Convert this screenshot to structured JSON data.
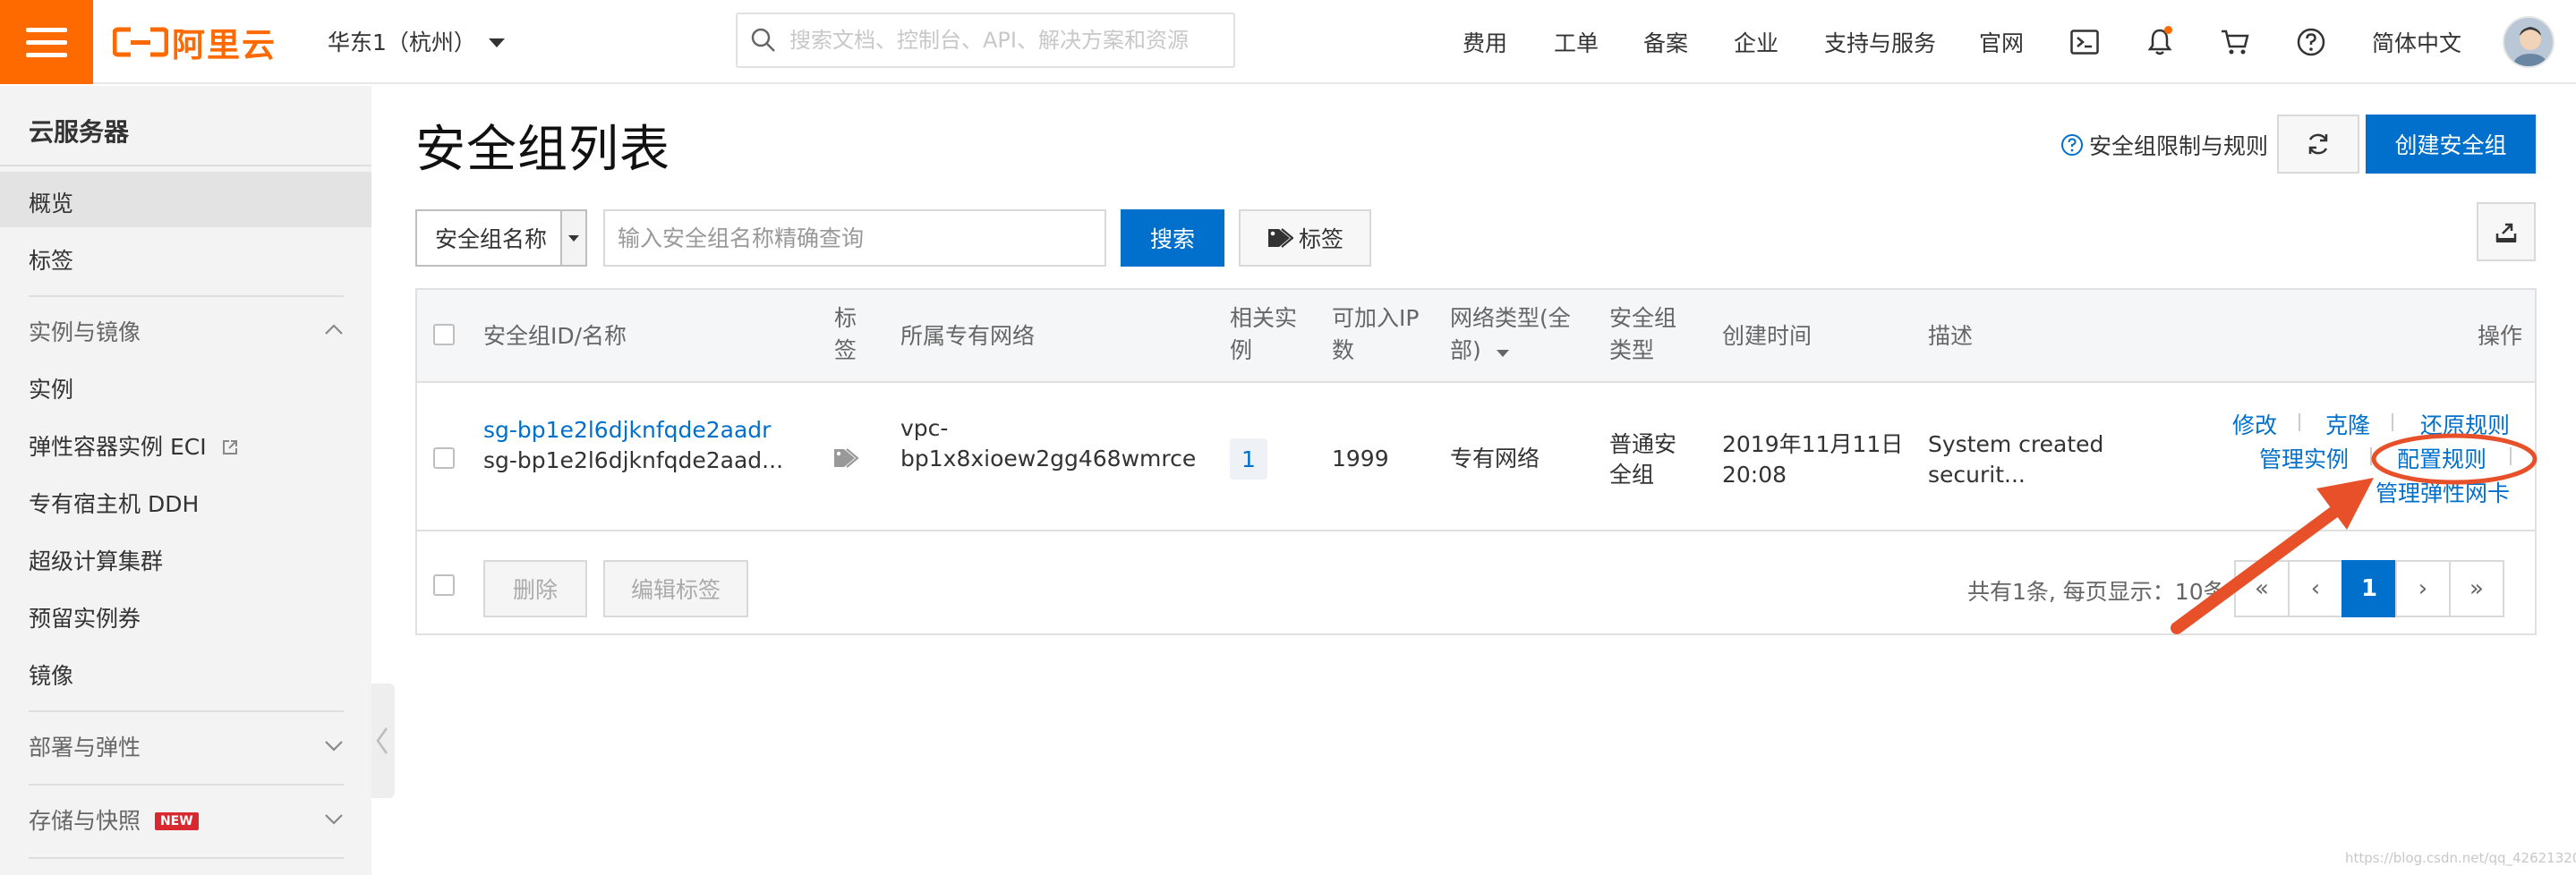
{
  "topbar": {
    "logo_text": "阿里云",
    "region": "华东1（杭州）",
    "search_placeholder": "搜索文档、控制台、API、解决方案和资源",
    "nav": [
      "费用",
      "工单",
      "备案",
      "企业",
      "支持与服务",
      "官网"
    ],
    "language": "简体中文",
    "icons": [
      "terminal-icon",
      "bell-icon",
      "cart-icon",
      "help-icon"
    ]
  },
  "sidebar": {
    "title": "云服务器",
    "items_top": [
      "概览",
      "标签"
    ],
    "group_instances": "实例与镜像",
    "group_items": [
      "实例",
      "弹性容器实例 ECI",
      "专有宿主机 DDH",
      "超级计算集群",
      "预留实例券",
      "镜像"
    ],
    "group_deploy": "部署与弹性",
    "group_storage": "存储与快照",
    "new_badge": "NEW"
  },
  "main": {
    "title": "安全组列表",
    "limit_link": "安全组限制与规则",
    "create_button": "创建安全组",
    "filter": {
      "select_label": "安全组名称",
      "input_placeholder": "输入安全组名称精确查询",
      "search_button": "搜索",
      "tag_button": "标签"
    },
    "table": {
      "headers": {
        "id_name": "安全组ID/名称",
        "tag_1": "标",
        "tag_2": "签",
        "vpc": "所属专有网络",
        "instances_1": "相关实",
        "instances_2": "例",
        "ip_1": "可加入IP",
        "ip_2": "数",
        "net_1": "网络类型(全",
        "net_2": "部)",
        "sgtype_1": "安全组",
        "sgtype_2": "类型",
        "created": "创建时间",
        "desc": "描述",
        "ops": "操作"
      },
      "row": {
        "id": "sg-bp1e2l6djknfqde2aadr",
        "name": "sg-bp1e2l6djknfqde2aad...",
        "vpc_1": "vpc-",
        "vpc_2": "bp1x8xioew2gg468wmrce",
        "instances": "1",
        "ip_count": "1999",
        "network_type": "专有网络",
        "sg_type_1": "普通安",
        "sg_type_2": "全组",
        "created_1": "2019年11月11日",
        "created_2": "20:08",
        "desc_1": "System created",
        "desc_2": "securit...",
        "ops": {
          "modify": "修改",
          "clone": "克隆",
          "restore": "还原规则",
          "manage_instances": "管理实例",
          "configure_rules": "配置规则",
          "manage_eni": "管理弹性网卡"
        }
      },
      "footer": {
        "delete": "删除",
        "edit_tags": "编辑标签",
        "total": "共有1条, 每页显示：10条",
        "pages": [
          "«",
          "‹",
          "1",
          "›",
          "»"
        ],
        "current_page": "1"
      }
    }
  },
  "annotation": {
    "color": "#e8502a"
  },
  "watermark": "https://blog.csdn.net/qq_42621320"
}
